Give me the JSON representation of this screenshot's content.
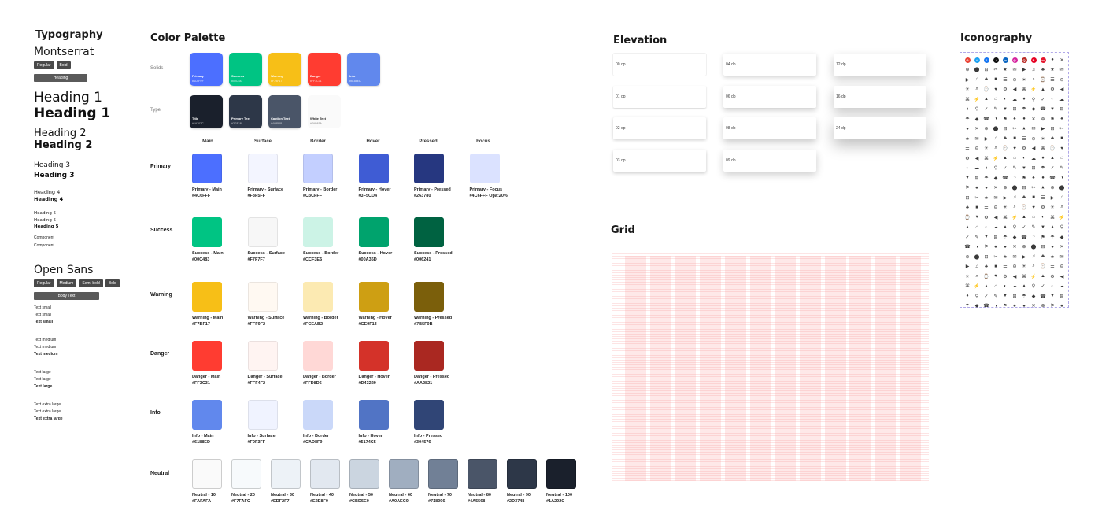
{
  "titles": {
    "typography": "Typography",
    "palette": "Color Palette",
    "elevation": "Elevation",
    "grid": "Grid",
    "iconography": "Iconography"
  },
  "typography": {
    "font1": "Montserrat",
    "font1_weights": [
      "Regular",
      "Bold"
    ],
    "font1_bar": "Heading",
    "h1": "Heading 1",
    "h2": "Heading 2",
    "h3": "Heading 3",
    "h4": "Heading 4",
    "h5": "Heading 5",
    "component": "Component",
    "font2": "Open Sans",
    "font2_weights": [
      "Regular",
      "Medium",
      "Semi-bold",
      "Bold"
    ],
    "font2_bar": "Body Text",
    "text_small": "Text small",
    "text_medium": "Text medium",
    "text_large": "Text large",
    "text_xl": "Text extra large"
  },
  "palette": {
    "solids_label": "Solids",
    "type_label": "Type",
    "solids": [
      {
        "name": "Primary",
        "hex": "#4C6FFF",
        "color": "#4C6FFF"
      },
      {
        "name": "Success",
        "hex": "#00C483",
        "color": "#00C483"
      },
      {
        "name": "Warning",
        "hex": "#F7BF17",
        "color": "#F7BF17"
      },
      {
        "name": "Danger",
        "hex": "#FF3C31",
        "color": "#FF3C31"
      },
      {
        "name": "Info",
        "hex": "#6188ED",
        "color": "#6188ED"
      }
    ],
    "types": [
      {
        "name": "Title",
        "hex": "#1A202C",
        "color": "#1A202C",
        "text": "#ffffff"
      },
      {
        "name": "Primary Text",
        "hex": "#2D3748",
        "color": "#2D3748",
        "text": "#ffffff"
      },
      {
        "name": "Caption Text",
        "hex": "#4A5568",
        "color": "#4A5568",
        "text": "#ffffff"
      },
      {
        "name": "White Text",
        "hex": "#FAFAFA",
        "color": "#FAFAFA",
        "text": "#222222"
      }
    ],
    "columns": [
      "Main",
      "Surface",
      "Border",
      "Hover",
      "Pressed",
      "Focus"
    ],
    "rows": [
      {
        "label": "Primary",
        "swatches": [
          {
            "name": "Primary - Main",
            "hex": "#4C6FFF",
            "color": "#4C6FFF"
          },
          {
            "name": "Primary - Surface",
            "hex": "#F3F5FF",
            "color": "#F3F5FF"
          },
          {
            "name": "Primary - Border",
            "hex": "#C3CFFF",
            "color": "#C3CFFF"
          },
          {
            "name": "Primary - Hover",
            "hex": "#3F5CD4",
            "color": "#3F5CD4"
          },
          {
            "name": "Primary - Pressed",
            "hex": "#263780",
            "color": "#263780"
          },
          {
            "name": "Primary - Focus",
            "hex": "#4C6FFF Opa:20%",
            "color": "#DBE2FF"
          }
        ]
      },
      {
        "label": "Success",
        "swatches": [
          {
            "name": "Success - Main",
            "hex": "#00C483",
            "color": "#00C483"
          },
          {
            "name": "Success - Surface",
            "hex": "#F7F7F7",
            "color": "#F7F7F7"
          },
          {
            "name": "Success - Border",
            "hex": "#CCF3E6",
            "color": "#CCF3E6"
          },
          {
            "name": "Success - Hover",
            "hex": "#00A36D",
            "color": "#00A36D"
          },
          {
            "name": "Success - Pressed",
            "hex": "#006241",
            "color": "#006241"
          }
        ]
      },
      {
        "label": "Warning",
        "swatches": [
          {
            "name": "Warning - Main",
            "hex": "#F7BF17",
            "color": "#F7BF17"
          },
          {
            "name": "Warning - Surface",
            "hex": "#FFF9F2",
            "color": "#FFF9F2"
          },
          {
            "name": "Warning - Border",
            "hex": "#FCEAB2",
            "color": "#FCEAB2"
          },
          {
            "name": "Warning - Hover",
            "hex": "#CE9F13",
            "color": "#CE9F13"
          },
          {
            "name": "Warning - Pressed",
            "hex": "#7B5F0B",
            "color": "#7B5F0B"
          }
        ]
      },
      {
        "label": "Danger",
        "swatches": [
          {
            "name": "Danger - Main",
            "hex": "#FF3C31",
            "color": "#FF3C31"
          },
          {
            "name": "Danger - Surface",
            "hex": "#FFF4F2",
            "color": "#FFF4F2"
          },
          {
            "name": "Danger - Border",
            "hex": "#FFD8D6",
            "color": "#FFD8D6"
          },
          {
            "name": "Danger - Hover",
            "hex": "#D43229",
            "color": "#D43229"
          },
          {
            "name": "Danger - Pressed",
            "hex": "#AA2821",
            "color": "#AA2821"
          }
        ]
      },
      {
        "label": "Info",
        "swatches": [
          {
            "name": "Info - Main",
            "hex": "#6188ED",
            "color": "#6188ED"
          },
          {
            "name": "Info - Surface",
            "hex": "#F0F3FF",
            "color": "#F0F3FF"
          },
          {
            "name": "Info - Border",
            "hex": "#CAD8F9",
            "color": "#CAD8F9"
          },
          {
            "name": "Info - Hover",
            "hex": "#5174C5",
            "color": "#5174C5"
          },
          {
            "name": "Info - Pressed",
            "hex": "#304576",
            "color": "#304576"
          }
        ]
      }
    ],
    "neutral_label": "Neutral",
    "neutrals": [
      {
        "name": "Neutral - 10",
        "hex": "#FAFAFA",
        "color": "#FAFAFA"
      },
      {
        "name": "Neutral - 20",
        "hex": "#F7FAFC",
        "color": "#F7FAFC"
      },
      {
        "name": "Neutral - 30",
        "hex": "#EDF2F7",
        "color": "#EDF2F7"
      },
      {
        "name": "Neutral - 40",
        "hex": "#E2E8F0",
        "color": "#E2E8F0"
      },
      {
        "name": "Neutral - 50",
        "hex": "#CBD5E0",
        "color": "#CBD5E0"
      },
      {
        "name": "Neutral - 60",
        "hex": "#A0AEC0",
        "color": "#A0AEC0"
      },
      {
        "name": "Neutral - 70",
        "hex": "#718096",
        "color": "#718096"
      },
      {
        "name": "Neutral - 80",
        "hex": "#4A5568",
        "color": "#4A5568"
      },
      {
        "name": "Neutral - 90",
        "hex": "#2D3748",
        "color": "#2D3748"
      },
      {
        "name": "Neutral - 100",
        "hex": "#1A202C",
        "color": "#1A202C"
      }
    ]
  },
  "elevation": {
    "cards": [
      "00 dp",
      "01 dp",
      "02 dp",
      "03 dp",
      "04 dp",
      "06 dp",
      "08 dp",
      "09 dp",
      "12 dp",
      "16 dp",
      "24 dp"
    ]
  },
  "grid": {
    "columns": 12
  },
  "icons": {
    "brands": [
      {
        "name": "google-icon",
        "color": "#EA4335",
        "glyph": "G"
      },
      {
        "name": "twitter-icon",
        "color": "#1DA1F2",
        "glyph": "t"
      },
      {
        "name": "facebook-icon",
        "color": "#1877F2",
        "glyph": "f"
      },
      {
        "name": "tiktok-icon",
        "color": "#111111",
        "glyph": "♪"
      },
      {
        "name": "linkedin-icon",
        "color": "#0A66C2",
        "glyph": "in"
      },
      {
        "name": "instagram-icon",
        "color": "#D6249F",
        "glyph": "◎"
      },
      {
        "name": "quora-icon",
        "color": "#B92B27",
        "glyph": "Q"
      },
      {
        "name": "pinterest-icon",
        "color": "#E60023",
        "glyph": "P"
      },
      {
        "name": "weibo-icon",
        "color": "#E6162D",
        "glyph": "w"
      }
    ],
    "glyphs": [
      "●",
      "■",
      "▲",
      "◆",
      "★",
      "♥",
      "✓",
      "✕",
      "☰",
      "⌂",
      "☎",
      "✉",
      "⚙",
      "✎",
      "⊕",
      "⊖",
      "◐",
      "◑",
      "▶",
      "◀",
      "▼",
      "⬤",
      "☀",
      "☁",
      "⚑",
      "♫",
      "⌘",
      "⊞",
      "⊟",
      "⌕",
      "♦",
      "♠",
      "♣",
      "⚡",
      "☂",
      "✂",
      "⌚",
      "⚲"
    ]
  }
}
